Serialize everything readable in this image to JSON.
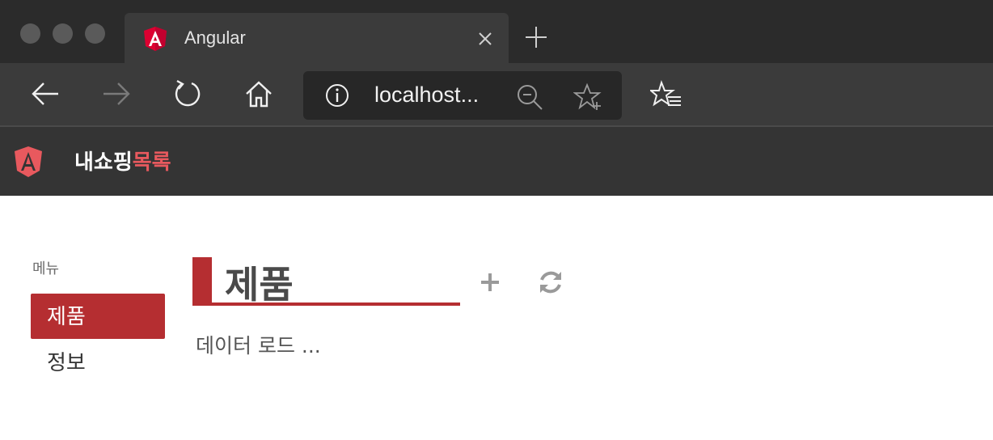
{
  "browser": {
    "tab_title": "Angular",
    "url": "localhost...",
    "colors": {
      "tabstrip": "#2b2b2b",
      "tab": "#3b3b3b",
      "urlbar": "#272727"
    },
    "icons": [
      "back-icon",
      "forward-icon",
      "refresh-icon",
      "home-icon",
      "info-icon",
      "zoom-out-icon",
      "add-favorite-icon",
      "favorites-list-icon",
      "close-icon",
      "new-tab-icon"
    ]
  },
  "app": {
    "brand_prefix": "내쇼핑",
    "brand_suffix": "목록",
    "brand_accent_color": "#e8595e",
    "header_color": "#343434"
  },
  "sidebar": {
    "caption": "메뉴",
    "items": [
      {
        "label": "제품",
        "active": true
      },
      {
        "label": "정보",
        "active": false
      }
    ],
    "active_color": "#b52e31"
  },
  "main": {
    "title": "제품",
    "status": "데이터 로드 ..."
  }
}
